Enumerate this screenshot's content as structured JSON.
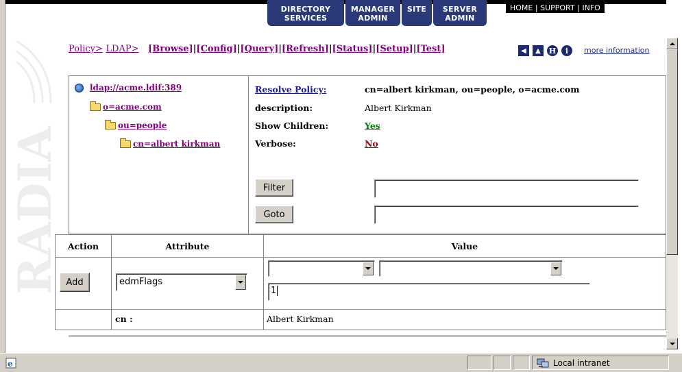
{
  "nav": {
    "tabs": [
      {
        "line1": "DIRECTORY",
        "line2": "SERVICES"
      },
      {
        "line1": "MANAGER",
        "line2": "ADMIN"
      },
      {
        "line1": "SITE",
        "line2": ""
      },
      {
        "line1": "SERVER",
        "line2": "ADMIN"
      }
    ],
    "home": "HOME",
    "support": "SUPPORT",
    "info": "INFO",
    "sep": "|"
  },
  "watermark": "RADIA",
  "breadcrumb": {
    "policy": "Policy>",
    "ldap": "LDAP>",
    "actions": [
      "[Browse]",
      "[Config]",
      "[Query]",
      "[Refresh]",
      "[Status]",
      "[Setup]",
      "[Test]"
    ],
    "sep": "|",
    "more_info": "more information"
  },
  "tree": {
    "root": "ldap://acme.ldif:389",
    "items": [
      "o=acme.com",
      "ou=people",
      "cn=albert kirkman"
    ]
  },
  "props": {
    "resolve_label": "Resolve Policy:",
    "resolve_value": "cn=albert kirkman, ou=people, o=acme.com",
    "description_label": "description:",
    "description_value": "Albert Kirkman",
    "show_children_label": "Show Children:",
    "show_children_value": "Yes",
    "verbose_label": "Verbose:",
    "verbose_value": "No",
    "filter_button": "Filter",
    "goto_button": "Goto",
    "filter_value": "",
    "goto_value": ""
  },
  "table": {
    "headers": {
      "action": "Action",
      "attribute": "Attribute",
      "value": "Value"
    },
    "add_button": "Add",
    "attribute_selected": "edmFlags",
    "value_select1": "",
    "value_select2": "",
    "value_input": "1",
    "row_attr": "cn :",
    "row_value": "Albert Kirkman"
  },
  "status": {
    "zone": "Local intranet"
  },
  "colors": {
    "nav_tab": "#2a3a78",
    "link_visited": "#800080",
    "link_blue": "#1a1aa6",
    "yes_green": "#008000",
    "no_red": "#a00000"
  }
}
